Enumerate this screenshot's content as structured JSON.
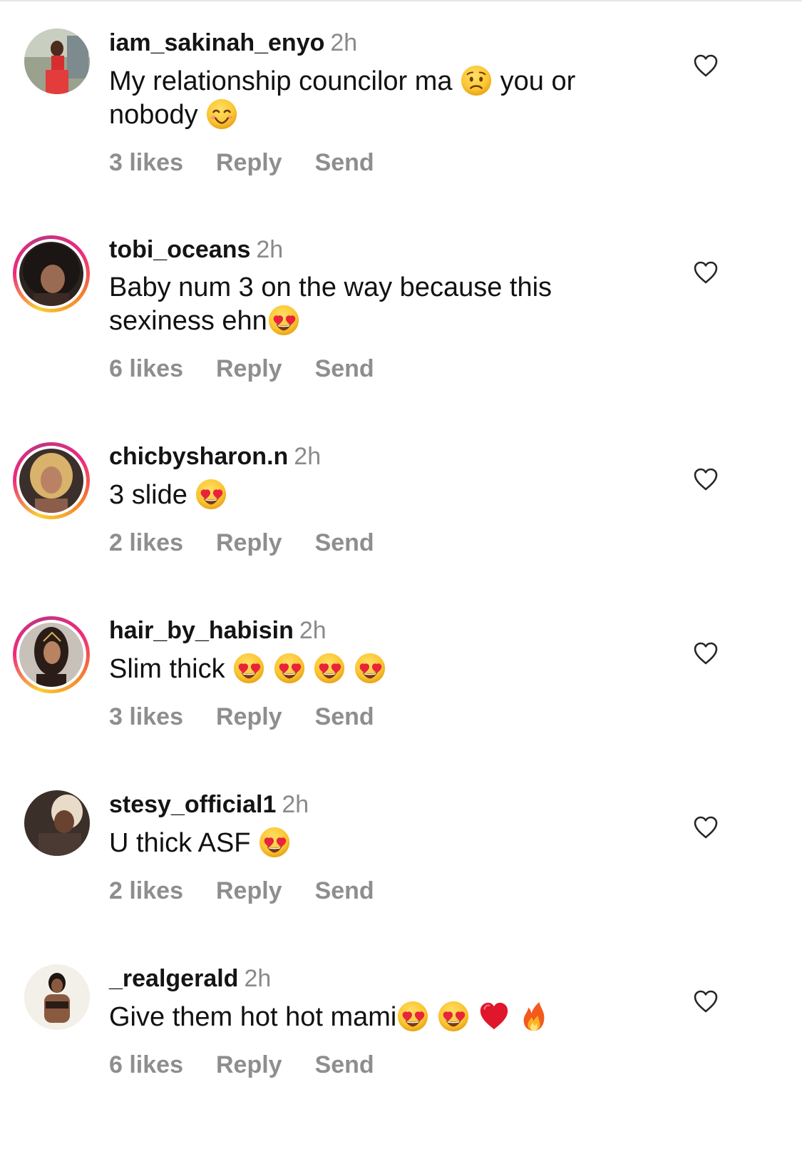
{
  "comments": [
    {
      "username": "iam_sakinah_enyo",
      "time": "2h",
      "text_parts": [
        "My relationship councilor ma ",
        " you or nobody "
      ],
      "emojis": [
        "worried-face",
        "smiling-face"
      ],
      "likes": "3 likes",
      "reply": "Reply",
      "send": "Send"
    },
    {
      "username": "tobi_oceans",
      "time": "2h",
      "text_parts": [
        "Baby num 3 on the way because this sexiness ehn"
      ],
      "emojis": [
        "heart-eyes"
      ],
      "likes": "6 likes",
      "reply": "Reply",
      "send": "Send"
    },
    {
      "username": "chicbysharon.n",
      "time": "2h",
      "text_parts": [
        "3 slide "
      ],
      "emojis": [
        "heart-eyes"
      ],
      "likes": "2 likes",
      "reply": "Reply",
      "send": "Send"
    },
    {
      "username": "hair_by_habisin",
      "time": "2h",
      "text_parts": [
        "Slim thick "
      ],
      "emojis": [
        "heart-eyes",
        "heart-eyes",
        "heart-eyes",
        "heart-eyes"
      ],
      "likes": "3 likes",
      "reply": "Reply",
      "send": "Send"
    },
    {
      "username": "stesy_official1",
      "time": "2h",
      "text_parts": [
        "U thick ASF "
      ],
      "emojis": [
        "heart-eyes"
      ],
      "likes": "2 likes",
      "reply": "Reply",
      "send": "Send"
    },
    {
      "username": "_realgerald",
      "time": "2h",
      "text_parts": [
        "Give them hot hot mami"
      ],
      "emojis": [
        "heart-eyes",
        "heart-eyes",
        "red-heart",
        "fire"
      ],
      "likes": "6 likes",
      "reply": "Reply",
      "send": "Send"
    }
  ],
  "colors": {
    "text": "#111111",
    "muted": "#8e8e8e",
    "story_ring_start": "#f9ce34",
    "story_ring_end": "#c13584"
  }
}
